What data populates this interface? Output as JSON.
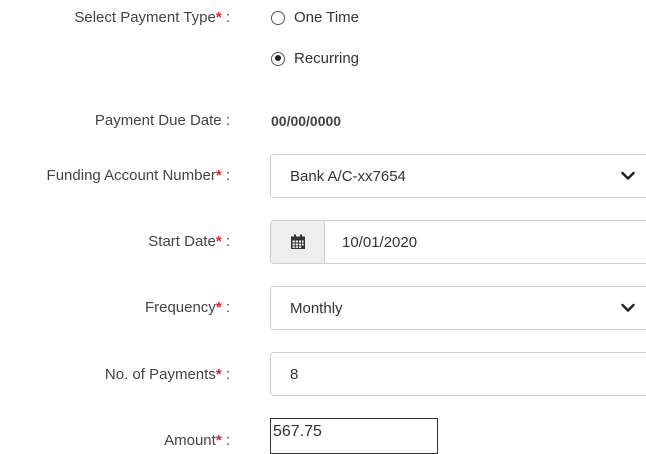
{
  "payment_type": {
    "label": "Select Payment Type",
    "required_mark": "*",
    "colon": ":",
    "options": [
      {
        "label": "One Time",
        "selected": false
      },
      {
        "label": "Recurring",
        "selected": true
      }
    ]
  },
  "due_date": {
    "label": "Payment Due Date",
    "colon": ":",
    "value": "00/00/0000"
  },
  "funding_account": {
    "label": "Funding Account Number",
    "required_mark": "*",
    "colon": ":",
    "value": "Bank A/C-xx7654",
    "icon": "chevron-down-icon"
  },
  "start_date": {
    "label": "Start Date",
    "required_mark": "*",
    "colon": ":",
    "value": "10/01/2020",
    "icon": "calendar-icon"
  },
  "frequency": {
    "label": "Frequency",
    "required_mark": "*",
    "colon": ":",
    "value": "Monthly",
    "icon": "chevron-down-icon"
  },
  "num_payments": {
    "label": "No. of Payments",
    "required_mark": "*",
    "colon": ":",
    "value": "8"
  },
  "amount": {
    "label": "Amount",
    "required_mark": "*",
    "colon": ":",
    "value": "567.75"
  },
  "colors": {
    "required": "#d9242b",
    "border": "#cfcfcf",
    "addon_bg": "#eeeeee"
  }
}
